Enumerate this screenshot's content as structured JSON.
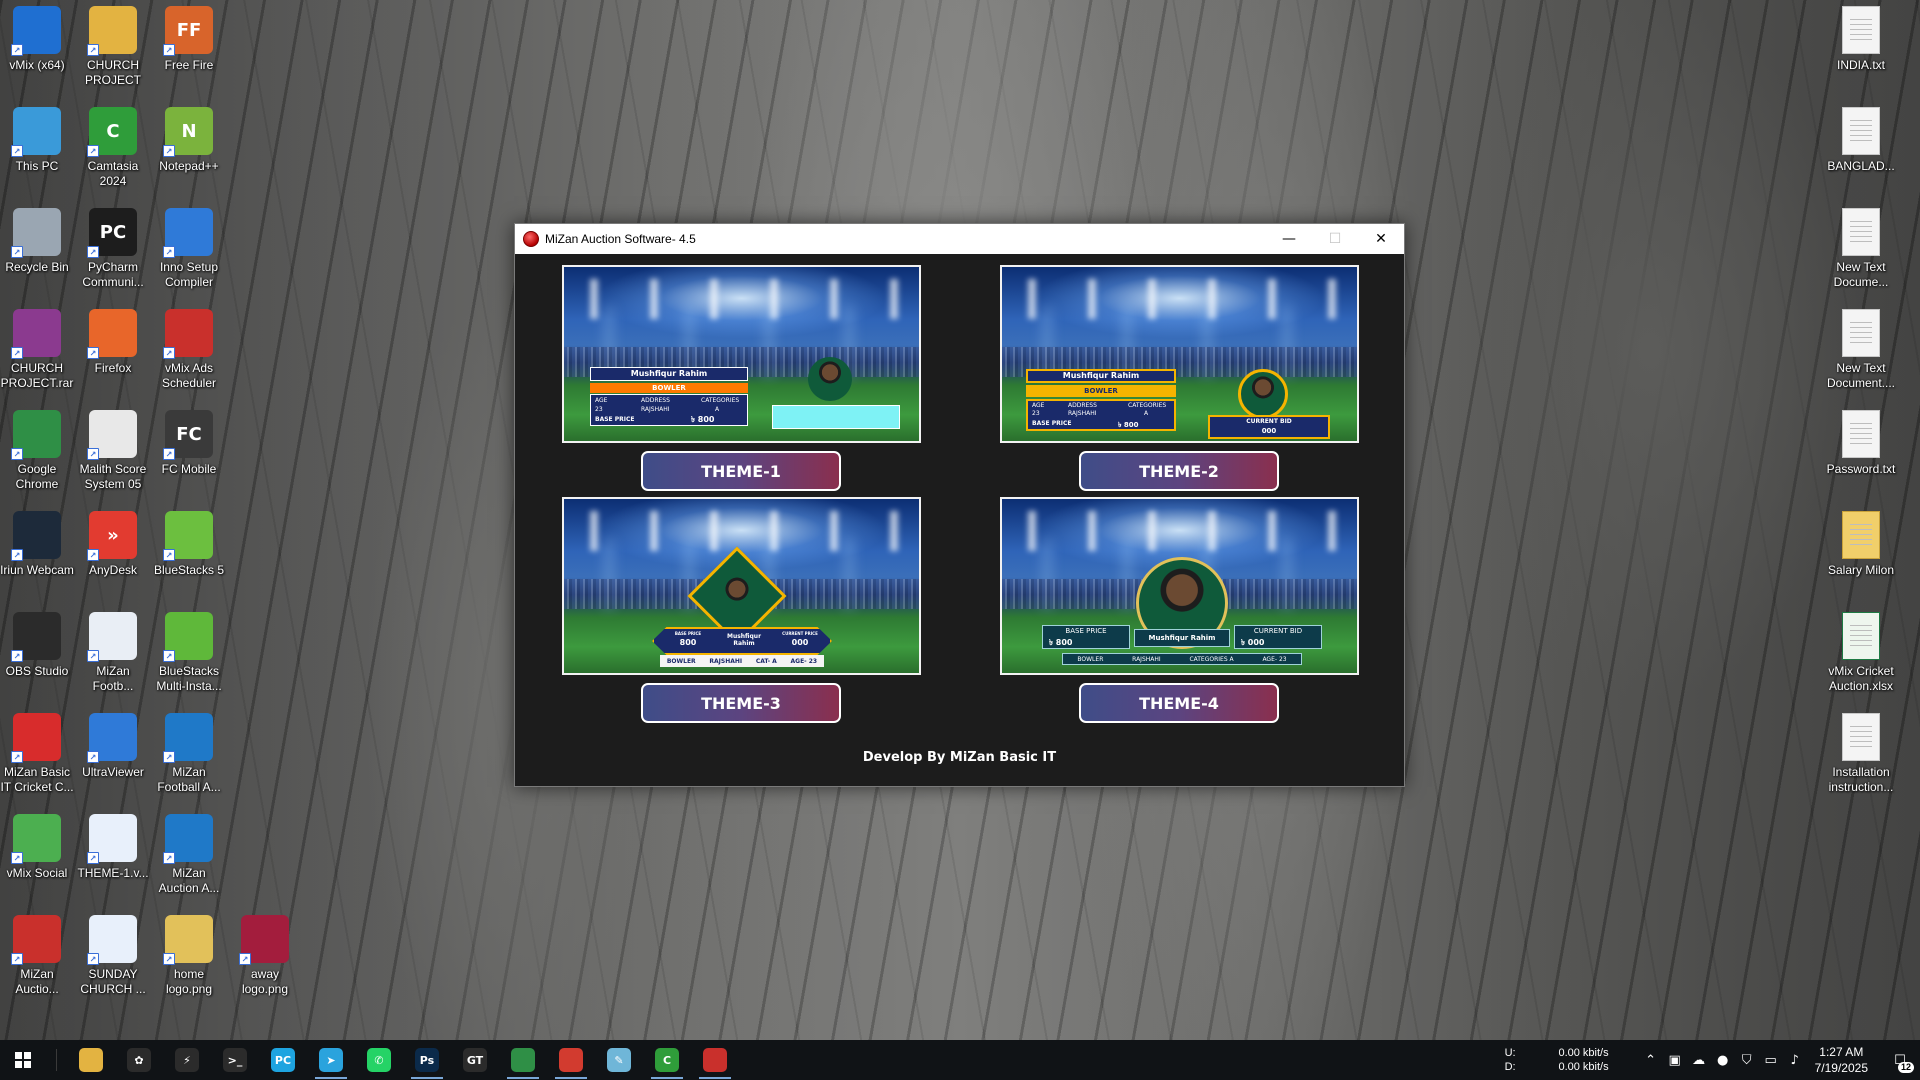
{
  "desktop": {
    "left_icons": [
      {
        "label": "vMix (x64)",
        "glyph": "",
        "color": "#1f6fd1",
        "icon": "vmix-icon"
      },
      {
        "label": "CHURCH PROJECT",
        "glyph": "",
        "color": "#e3b341",
        "icon": "folder-icon"
      },
      {
        "label": "Free Fire",
        "glyph": "FF",
        "color": "#d8642b",
        "icon": "freefire-icon"
      },
      {
        "label": "This PC",
        "glyph": "",
        "color": "#3a9ad9",
        "icon": "computer-icon"
      },
      {
        "label": "Camtasia 2024",
        "glyph": "C",
        "color": "#2f9d3a",
        "icon": "camtasia-icon"
      },
      {
        "label": "Notepad++",
        "glyph": "N",
        "color": "#7bb33d",
        "icon": "notepadpp-icon"
      },
      {
        "label": "Recycle Bin",
        "glyph": "",
        "color": "#9aa6b2",
        "icon": "recycle-bin-icon"
      },
      {
        "label": "PyCharm Communi...",
        "glyph": "PC",
        "color": "#1d1d1d",
        "icon": "pycharm-icon"
      },
      {
        "label": "Inno Setup Compiler",
        "glyph": "",
        "color": "#2f7ad8",
        "icon": "inno-setup-icon"
      },
      {
        "label": "CHURCH PROJECT.rar",
        "glyph": "",
        "color": "#8b3a8f",
        "icon": "rar-archive-icon"
      },
      {
        "label": "Firefox",
        "glyph": "",
        "color": "#e8662a",
        "icon": "firefox-icon"
      },
      {
        "label": "vMix Ads Scheduler",
        "glyph": "",
        "color": "#c9302c",
        "icon": "vmix-ads-icon"
      },
      {
        "label": "Google Chrome",
        "glyph": "",
        "color": "#2f8f46",
        "icon": "chrome-icon"
      },
      {
        "label": "Malith Score System 05",
        "glyph": "",
        "color": "#e8e8e8",
        "icon": "score-system-icon"
      },
      {
        "label": "FC Mobile",
        "glyph": "FC",
        "color": "#3a3a3a",
        "icon": "fc-mobile-icon"
      },
      {
        "label": "Iriun Webcam",
        "glyph": "",
        "color": "#1d2a3a",
        "icon": "webcam-icon"
      },
      {
        "label": "AnyDesk",
        "glyph": "»",
        "color": "#e23b30",
        "icon": "anydesk-icon"
      },
      {
        "label": "BlueStacks 5",
        "glyph": "",
        "color": "#6cbf3f",
        "icon": "bluestacks-icon"
      },
      {
        "label": "OBS Studio",
        "glyph": "",
        "color": "#2b2b2b",
        "icon": "obs-icon"
      },
      {
        "label": "MiZan Footb...",
        "glyph": "",
        "color": "#e9eef5",
        "icon": "mizan-football-icon"
      },
      {
        "label": "BlueStacks Multi-Insta...",
        "glyph": "",
        "color": "#5fb83a",
        "icon": "bluestacks-multi-icon"
      },
      {
        "label": "MiZan Basic IT Cricket C...",
        "glyph": "",
        "color": "#d82c2c",
        "icon": "mizan-cricket-icon"
      },
      {
        "label": "UltraViewer",
        "glyph": "",
        "color": "#2f7ad8",
        "icon": "ultraviewer-icon"
      },
      {
        "label": "MiZan Football A...",
        "glyph": "",
        "color": "#1f79c8",
        "icon": "mizan-football-auction-icon"
      },
      {
        "label": "vMix Social",
        "glyph": "",
        "color": "#4caf50",
        "icon": "vmix-social-icon"
      },
      {
        "label": "THEME-1.v...",
        "glyph": "",
        "color": "#e8f0fb",
        "icon": "vmix-project-icon"
      },
      {
        "label": "MiZan Auction A...",
        "glyph": "",
        "color": "#1f79c8",
        "icon": "mizan-auction-icon"
      },
      {
        "label": "MiZan Auctio...",
        "glyph": "",
        "color": "#c9302c",
        "icon": "mizan-auction-app-icon"
      },
      {
        "label": "SUNDAY CHURCH ...",
        "glyph": "",
        "color": "#e8f0fb",
        "icon": "vmix-project-icon"
      },
      {
        "label": "home logo.png",
        "glyph": "",
        "color": "#e2c15a",
        "icon": "home-logo-icon"
      },
      {
        "label": "away logo.png",
        "glyph": "",
        "color": "#a31d3d",
        "icon": "away-logo-icon"
      }
    ],
    "right_icons": [
      {
        "label": "INDIA.txt",
        "icon": "text-file-icon"
      },
      {
        "label": "BANGLAD...",
        "icon": "text-file-icon"
      },
      {
        "label": "New Text Docume...",
        "icon": "text-file-icon"
      },
      {
        "label": "New Text Document....",
        "icon": "text-file-icon"
      },
      {
        "label": "Password.txt",
        "icon": "text-file-icon"
      },
      {
        "label": "Salary Milon",
        "icon": "zip-folder-icon"
      },
      {
        "label": "vMix Cricket Auction.xlsx",
        "icon": "excel-file-icon"
      },
      {
        "label": "Installation instruction...",
        "icon": "text-file-icon"
      }
    ]
  },
  "window": {
    "title": "MiZan Auction Software- 4.5",
    "minimize_glyph": "—",
    "maximize_glyph": "☐",
    "close_glyph": "✕",
    "themes": [
      {
        "button": "THEME-1",
        "player": "Mushfiqur Rahim",
        "role": "BOWLER",
        "base_price_label": "BASE PRICE",
        "base_price": "৳ 800",
        "age_label": "AGE",
        "age": "23",
        "address_label": "ADDRESS",
        "address": "RAJSHAHI",
        "cat_label": "CATEGORIES",
        "cat": "A"
      },
      {
        "button": "THEME-2",
        "player": "Mushfiqur Rahim",
        "role": "BOWLER",
        "base_price_label": "BASE PRICE",
        "base_price": "৳ 800",
        "current_bid_label": "CURRENT BID",
        "current_bid": "000",
        "age_label": "AGE",
        "age": "23",
        "address_label": "ADDRESS",
        "address": "RAJSHAHI",
        "cat_label": "CATEGORIES",
        "cat": "A"
      },
      {
        "button": "THEME-3",
        "player": "Mushfiqur Rahim",
        "base_price_label": "BASE PRICE",
        "base_price": "800",
        "current_bid_label": "CURRENT PRICE",
        "current_bid": "000",
        "role": "BOWLER",
        "address": "RAJSHAHI",
        "cat": "CAT- A",
        "age": "AGE- 23"
      },
      {
        "button": "THEME-4",
        "player": "Mushfiqur Rahim",
        "base_price_label": "BASE PRICE",
        "base_price": "৳ 800",
        "current_bid_label": "CURRENT BID",
        "current_bid": "৳ 000",
        "role": "BOWLER",
        "address": "RAJSHAHI",
        "cat": "CATEGORIES A",
        "age": "AGE- 23"
      }
    ],
    "credit": "Develop By MiZan Basic IT"
  },
  "taskbar": {
    "apps": [
      {
        "name": "file-explorer",
        "glyph": "",
        "color": "#e3b341",
        "running": false
      },
      {
        "name": "chatgpt",
        "glyph": "✿",
        "color": "#2b2b2b",
        "running": false
      },
      {
        "name": "winamp",
        "glyph": "⚡",
        "color": "#2b2b2b",
        "running": false
      },
      {
        "name": "terminal",
        "glyph": ">_",
        "color": "#2b2b2b",
        "running": false
      },
      {
        "name": "pycharm",
        "glyph": "PC",
        "color": "#1ea4e0",
        "running": false
      },
      {
        "name": "telegram",
        "glyph": "➤",
        "color": "#2aa3dd",
        "running": true
      },
      {
        "name": "whatsapp",
        "glyph": "✆",
        "color": "#25d366",
        "running": false
      },
      {
        "name": "photoshop",
        "glyph": "Ps",
        "color": "#0b2a4a",
        "running": true
      },
      {
        "name": "gpu-tweak",
        "glyph": "GT",
        "color": "#2b2b2b",
        "running": false
      },
      {
        "name": "chrome",
        "glyph": "",
        "color": "#2f8f46",
        "running": true
      },
      {
        "name": "chrome-profile",
        "glyph": "",
        "color": "#d23b2f",
        "running": true
      },
      {
        "name": "notepad",
        "glyph": "✎",
        "color": "#6fb6d8",
        "running": false
      },
      {
        "name": "camtasia",
        "glyph": "C",
        "color": "#2f9d3a",
        "running": true
      },
      {
        "name": "mizan-auction",
        "glyph": "",
        "color": "#c9302c",
        "running": true
      }
    ],
    "net_up_label": "U:",
    "net_up": "0.00 kbit/s",
    "net_down_label": "D:",
    "net_down": "0.00 kbit/s",
    "time": "1:27 AM",
    "date": "7/19/2025",
    "notification_count": "12"
  }
}
